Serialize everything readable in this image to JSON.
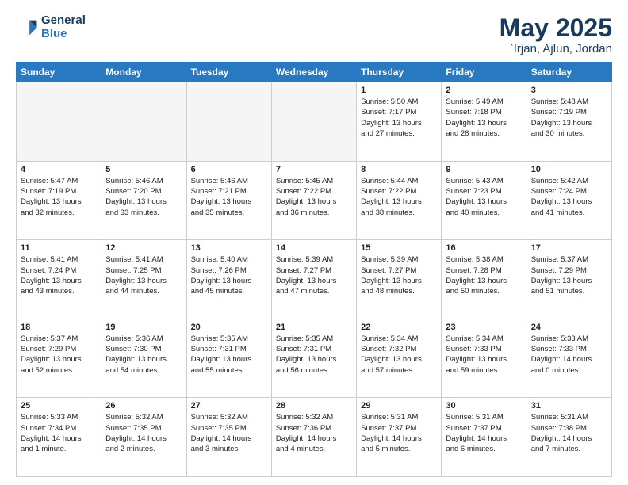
{
  "logo": {
    "line1": "General",
    "line2": "Blue"
  },
  "title": "May 2025",
  "subtitle": "`Irjan, Ajlun, Jordan",
  "weekdays": [
    "Sunday",
    "Monday",
    "Tuesday",
    "Wednesday",
    "Thursday",
    "Friday",
    "Saturday"
  ],
  "weeks": [
    [
      {
        "day": "",
        "info": ""
      },
      {
        "day": "",
        "info": ""
      },
      {
        "day": "",
        "info": ""
      },
      {
        "day": "",
        "info": ""
      },
      {
        "day": "1",
        "info": "Sunrise: 5:50 AM\nSunset: 7:17 PM\nDaylight: 13 hours\nand 27 minutes."
      },
      {
        "day": "2",
        "info": "Sunrise: 5:49 AM\nSunset: 7:18 PM\nDaylight: 13 hours\nand 28 minutes."
      },
      {
        "day": "3",
        "info": "Sunrise: 5:48 AM\nSunset: 7:19 PM\nDaylight: 13 hours\nand 30 minutes."
      }
    ],
    [
      {
        "day": "4",
        "info": "Sunrise: 5:47 AM\nSunset: 7:19 PM\nDaylight: 13 hours\nand 32 minutes."
      },
      {
        "day": "5",
        "info": "Sunrise: 5:46 AM\nSunset: 7:20 PM\nDaylight: 13 hours\nand 33 minutes."
      },
      {
        "day": "6",
        "info": "Sunrise: 5:46 AM\nSunset: 7:21 PM\nDaylight: 13 hours\nand 35 minutes."
      },
      {
        "day": "7",
        "info": "Sunrise: 5:45 AM\nSunset: 7:22 PM\nDaylight: 13 hours\nand 36 minutes."
      },
      {
        "day": "8",
        "info": "Sunrise: 5:44 AM\nSunset: 7:22 PM\nDaylight: 13 hours\nand 38 minutes."
      },
      {
        "day": "9",
        "info": "Sunrise: 5:43 AM\nSunset: 7:23 PM\nDaylight: 13 hours\nand 40 minutes."
      },
      {
        "day": "10",
        "info": "Sunrise: 5:42 AM\nSunset: 7:24 PM\nDaylight: 13 hours\nand 41 minutes."
      }
    ],
    [
      {
        "day": "11",
        "info": "Sunrise: 5:41 AM\nSunset: 7:24 PM\nDaylight: 13 hours\nand 43 minutes."
      },
      {
        "day": "12",
        "info": "Sunrise: 5:41 AM\nSunset: 7:25 PM\nDaylight: 13 hours\nand 44 minutes."
      },
      {
        "day": "13",
        "info": "Sunrise: 5:40 AM\nSunset: 7:26 PM\nDaylight: 13 hours\nand 45 minutes."
      },
      {
        "day": "14",
        "info": "Sunrise: 5:39 AM\nSunset: 7:27 PM\nDaylight: 13 hours\nand 47 minutes."
      },
      {
        "day": "15",
        "info": "Sunrise: 5:39 AM\nSunset: 7:27 PM\nDaylight: 13 hours\nand 48 minutes."
      },
      {
        "day": "16",
        "info": "Sunrise: 5:38 AM\nSunset: 7:28 PM\nDaylight: 13 hours\nand 50 minutes."
      },
      {
        "day": "17",
        "info": "Sunrise: 5:37 AM\nSunset: 7:29 PM\nDaylight: 13 hours\nand 51 minutes."
      }
    ],
    [
      {
        "day": "18",
        "info": "Sunrise: 5:37 AM\nSunset: 7:29 PM\nDaylight: 13 hours\nand 52 minutes."
      },
      {
        "day": "19",
        "info": "Sunrise: 5:36 AM\nSunset: 7:30 PM\nDaylight: 13 hours\nand 54 minutes."
      },
      {
        "day": "20",
        "info": "Sunrise: 5:35 AM\nSunset: 7:31 PM\nDaylight: 13 hours\nand 55 minutes."
      },
      {
        "day": "21",
        "info": "Sunrise: 5:35 AM\nSunset: 7:31 PM\nDaylight: 13 hours\nand 56 minutes."
      },
      {
        "day": "22",
        "info": "Sunrise: 5:34 AM\nSunset: 7:32 PM\nDaylight: 13 hours\nand 57 minutes."
      },
      {
        "day": "23",
        "info": "Sunrise: 5:34 AM\nSunset: 7:33 PM\nDaylight: 13 hours\nand 59 minutes."
      },
      {
        "day": "24",
        "info": "Sunrise: 5:33 AM\nSunset: 7:33 PM\nDaylight: 14 hours\nand 0 minutes."
      }
    ],
    [
      {
        "day": "25",
        "info": "Sunrise: 5:33 AM\nSunset: 7:34 PM\nDaylight: 14 hours\nand 1 minute."
      },
      {
        "day": "26",
        "info": "Sunrise: 5:32 AM\nSunset: 7:35 PM\nDaylight: 14 hours\nand 2 minutes."
      },
      {
        "day": "27",
        "info": "Sunrise: 5:32 AM\nSunset: 7:35 PM\nDaylight: 14 hours\nand 3 minutes."
      },
      {
        "day": "28",
        "info": "Sunrise: 5:32 AM\nSunset: 7:36 PM\nDaylight: 14 hours\nand 4 minutes."
      },
      {
        "day": "29",
        "info": "Sunrise: 5:31 AM\nSunset: 7:37 PM\nDaylight: 14 hours\nand 5 minutes."
      },
      {
        "day": "30",
        "info": "Sunrise: 5:31 AM\nSunset: 7:37 PM\nDaylight: 14 hours\nand 6 minutes."
      },
      {
        "day": "31",
        "info": "Sunrise: 5:31 AM\nSunset: 7:38 PM\nDaylight: 14 hours\nand 7 minutes."
      }
    ]
  ]
}
